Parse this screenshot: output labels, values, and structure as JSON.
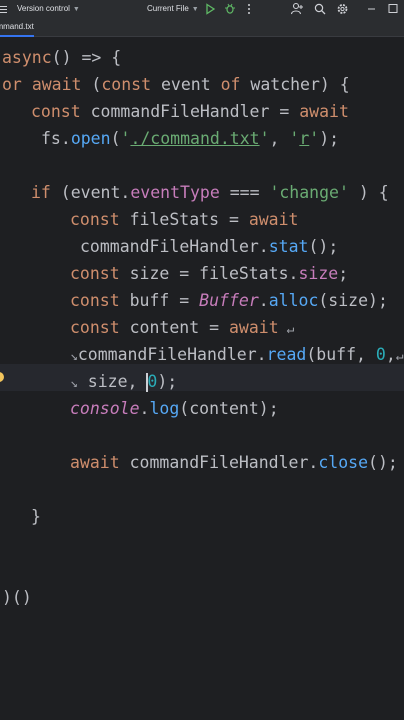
{
  "toolbar": {
    "version_control_label": "Version control",
    "run_config_label": "Current File"
  },
  "tabs": [
    {
      "label": "command.txt"
    }
  ],
  "code": {
    "line1": {
      "t1": "async",
      "t2": "() => {"
    },
    "line2": {
      "t1": "or",
      "t2": " ",
      "t3": "await",
      "t4": " (",
      "t5": "const",
      "t6": " event ",
      "t7": "of",
      "t8": " watcher) {"
    },
    "line3": {
      "t1": "const",
      "t2": " commandFileHandler = ",
      "t3": "await"
    },
    "line4": {
      "t1": "fs.",
      "t2": "open",
      "t3": "(",
      "t4": "'",
      "t5": "./command.txt",
      "t6": "'",
      "t7": ", ",
      "t8": "'",
      "t9": "r",
      "t10": "'",
      "t11": ");"
    },
    "line5": {
      "t1": "if",
      "t2": " (event.",
      "t3": "eventType",
      "t4": " === ",
      "t5": "'change'",
      "t6": " ) {"
    },
    "line6": {
      "t1": "const",
      "t2": " fileStats = ",
      "t3": "await"
    },
    "line7": {
      "t1": "commandFileHandler.",
      "t2": "stat",
      "t3": "();"
    },
    "line8": {
      "t1": "const",
      "t2": " size = fileStats.",
      "t3": "size",
      "t4": ";"
    },
    "line9": {
      "t1": "const",
      "t2": " buff = ",
      "t3": "Buffer",
      "t4": ".",
      "t5": "alloc",
      "t6": "(size);"
    },
    "line10": {
      "t1": "const",
      "t2": " content = ",
      "t3": "await"
    },
    "line11": {
      "t1": "commandFileHandler.",
      "t2": "read",
      "t3": "(buff, ",
      "t4": "0",
      "t5": ","
    },
    "line12": {
      "t1": " size, ",
      "t2": "0",
      "t3": ");"
    },
    "line13": {
      "t1": "console",
      "t2": ".",
      "t3": "log",
      "t4": "(content);"
    },
    "line14": {
      "t1": "await",
      "t2": " commandFileHandler.",
      "t3": "close",
      "t4": "();"
    },
    "line15": {
      "t1": "}"
    },
    "line16": {
      "t1": ")()"
    }
  },
  "colors": {
    "background": "#1e1f22",
    "keyword": "#cf8e6d",
    "function": "#56a8f5",
    "string": "#6aab73",
    "number": "#2aacb8",
    "property": "#c77dbb",
    "text": "#bcbec4",
    "run": "#5fb865",
    "debug": "#5fb865"
  }
}
